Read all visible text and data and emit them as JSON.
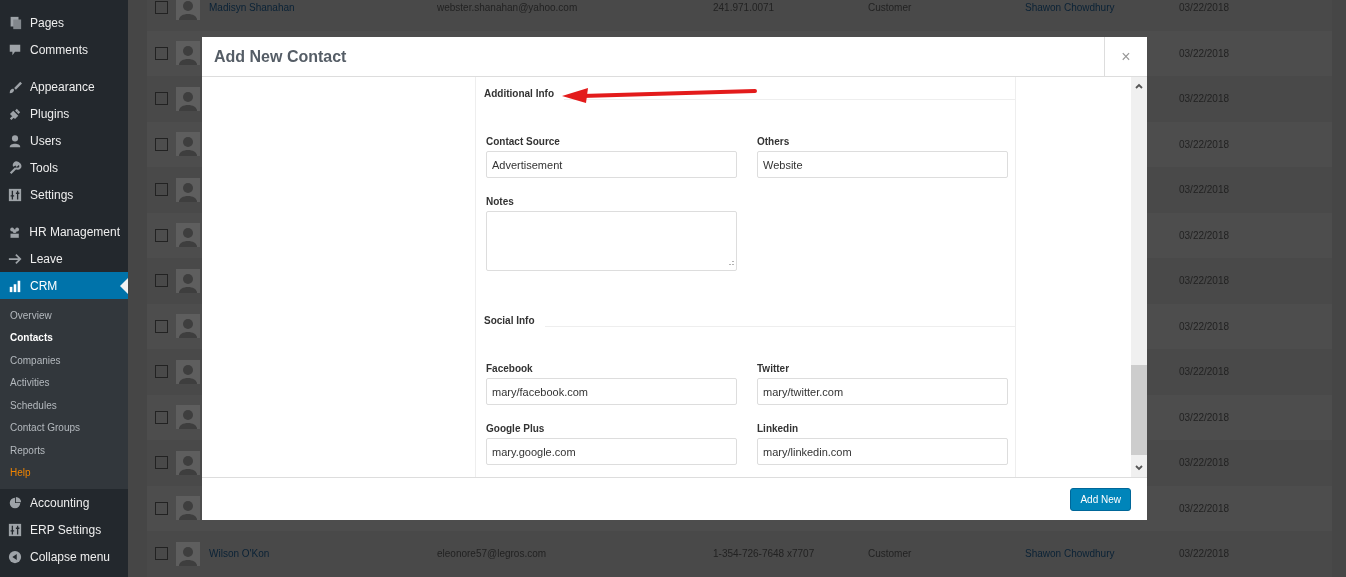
{
  "sidebar": {
    "groups": [
      {
        "items": [
          {
            "label": "Pages",
            "selected": false
          },
          {
            "label": "Comments",
            "selected": false
          }
        ]
      },
      {
        "items": [
          {
            "label": "Appearance",
            "selected": false
          },
          {
            "label": "Plugins",
            "selected": false
          },
          {
            "label": "Users",
            "selected": false
          },
          {
            "label": "Tools",
            "selected": false
          },
          {
            "label": "Settings",
            "selected": false
          }
        ]
      },
      {
        "items": [
          {
            "label": "HR Management",
            "selected": false
          },
          {
            "label": "Leave",
            "selected": false
          },
          {
            "label": "CRM",
            "selected": true,
            "children": [
              {
                "label": "Overview",
                "selected": false,
                "kind": "item"
              },
              {
                "label": "Contacts",
                "selected": true,
                "kind": "item"
              },
              {
                "label": "Companies",
                "selected": false,
                "kind": "item"
              },
              {
                "label": "Activities",
                "selected": false,
                "kind": "item"
              },
              {
                "label": "Schedules",
                "selected": false,
                "kind": "item"
              },
              {
                "label": "Contact Groups",
                "selected": false,
                "kind": "item"
              },
              {
                "label": "Reports",
                "selected": false,
                "kind": "item"
              },
              {
                "label": "Help",
                "selected": false,
                "kind": "help"
              }
            ]
          },
          {
            "label": "Accounting",
            "selected": false
          },
          {
            "label": "ERP Settings",
            "selected": false
          },
          {
            "label": "Collapse menu",
            "selected": false
          }
        ]
      }
    ]
  },
  "table": {
    "rows": [
      {
        "checked": false,
        "name": "Madisyn Shanahan",
        "email": "webster.shanahan@yahoo.com",
        "phone": "241.971.0071",
        "type": "Customer",
        "owner": "Shawon Chowdhury",
        "date": "03/22/2018"
      },
      {
        "checked": false,
        "date": "03/22/2018"
      },
      {
        "checked": false,
        "date": "03/22/2018"
      },
      {
        "checked": false,
        "date": "03/22/2018"
      },
      {
        "checked": false,
        "date": "03/22/2018"
      },
      {
        "checked": false,
        "date": "03/22/2018"
      },
      {
        "checked": false,
        "date": "03/22/2018"
      },
      {
        "checked": false,
        "date": "03/22/2018"
      },
      {
        "checked": false,
        "date": "03/22/2018"
      },
      {
        "checked": false,
        "date": "03/22/2018"
      },
      {
        "checked": false,
        "date": "03/22/2018"
      },
      {
        "checked": false,
        "date": "03/22/2018"
      },
      {
        "checked": false,
        "name": "Wilson O'Kon",
        "email": "eleonore57@legros.com",
        "phone": "1-354-726-7648 x7707",
        "type": "Customer",
        "owner": "Shawon Chowdhury",
        "date": "03/22/2018"
      }
    ]
  },
  "modal": {
    "title": "Add New Contact",
    "close": "×",
    "sections": [
      {
        "title": "Additional Info",
        "fields": [
          {
            "label": "Contact Source",
            "value": "Advertisement",
            "kind": "input"
          },
          {
            "label": "Others",
            "value": "Website",
            "kind": "input"
          },
          {
            "label": "Notes",
            "kind": "textarea"
          }
        ]
      },
      {
        "title": "Social Info",
        "fields": [
          {
            "label": "Facebook",
            "value": "mary/facebook.com",
            "kind": "input"
          },
          {
            "label": "Twitter",
            "value": "mary/twitter.com",
            "kind": "input"
          },
          {
            "label": "Google Plus",
            "value": "mary.google.com",
            "kind": "input"
          },
          {
            "label": "Linkedin",
            "value": "mary/linkedin.com",
            "kind": "input"
          }
        ]
      }
    ],
    "submit": "Add New"
  }
}
